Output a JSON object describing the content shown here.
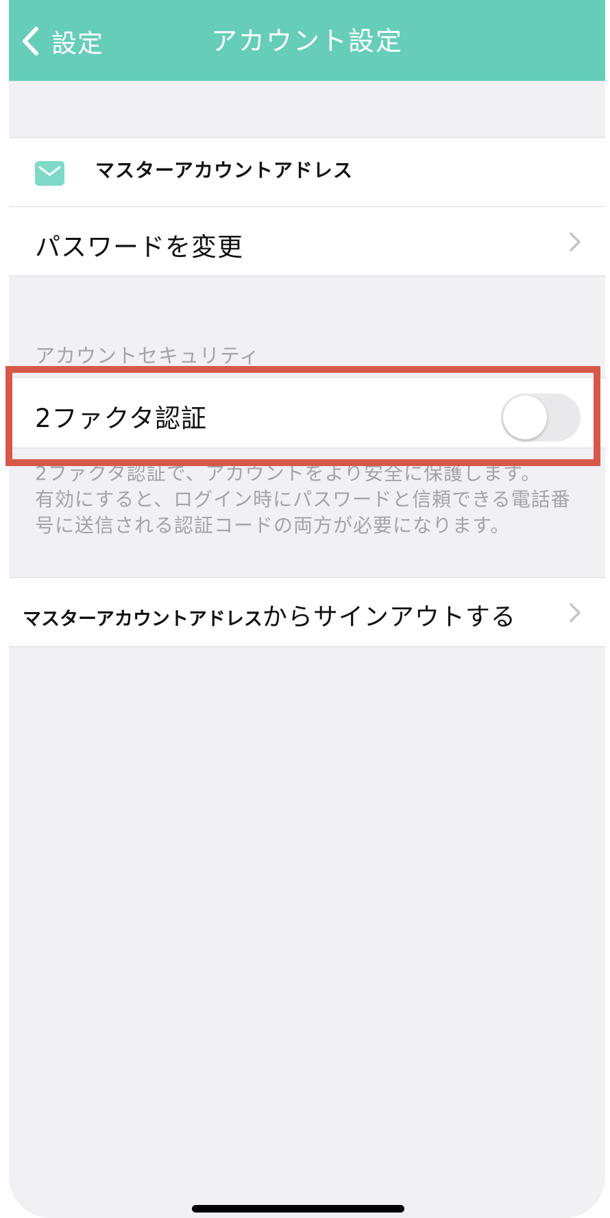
{
  "navbar": {
    "back_label": "設定",
    "title": "アカウント設定"
  },
  "account": {
    "email_label": "マスターアカウントアドレス",
    "change_password_label": "パスワードを変更"
  },
  "security": {
    "section_header": "アカウントセキュリティ",
    "two_factor_label": "2ファクタ認証",
    "two_factor_enabled": false,
    "footer_line1": "2ファクタ認証で、アカウントをより安全に保護します。",
    "footer_line2": "有効にすると、ログイン時にパスワードと信頼できる電話番号に送信される認証コードの両方が必要になります。"
  },
  "signout": {
    "email_label": "マスターアカウントアドレス",
    "suffix_label": "からサインアウトする"
  },
  "colors": {
    "navbar": "#66cdb9",
    "mail_icon": "#7fd9c8",
    "highlight": "#d7584a",
    "background": "#f0f0f5"
  }
}
